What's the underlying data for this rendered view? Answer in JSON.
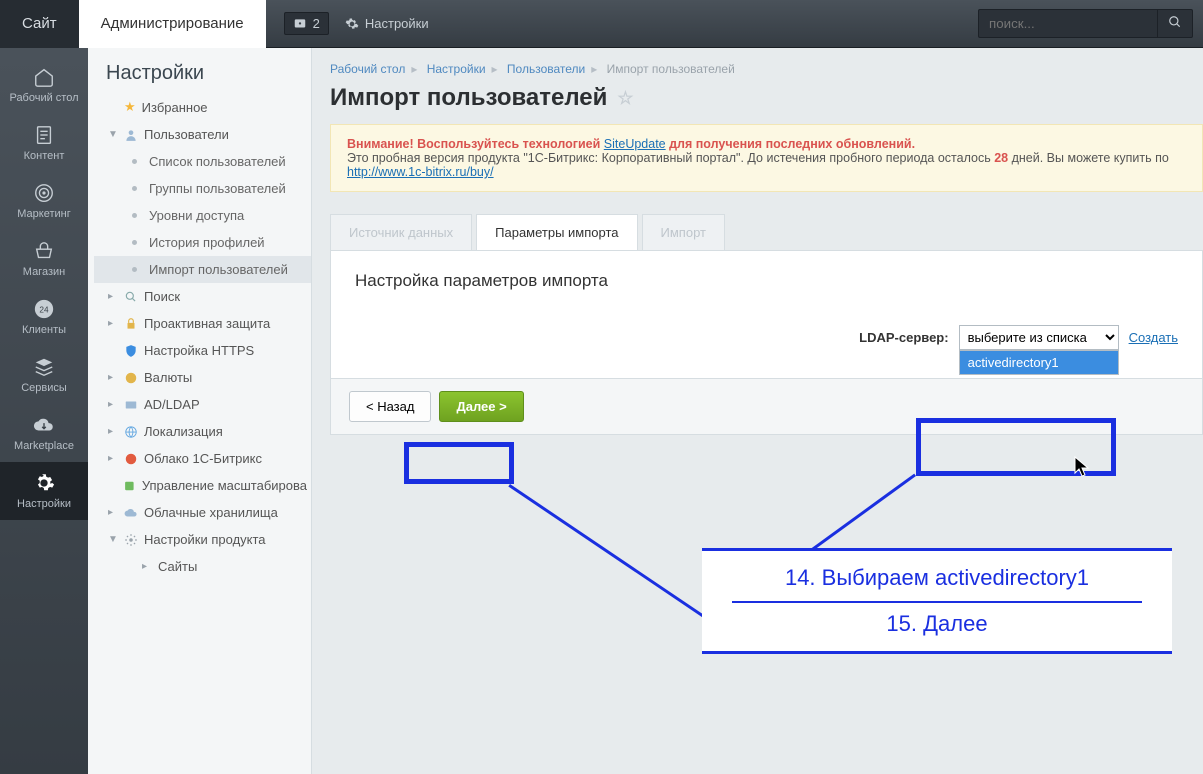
{
  "topbar": {
    "site": "Сайт",
    "admin": "Администрирование",
    "notif_count": "2",
    "settings": "Настройки",
    "search_placeholder": "поиск..."
  },
  "iconbar": [
    {
      "name": "desk",
      "label": "Рабочий стол"
    },
    {
      "name": "content",
      "label": "Контент"
    },
    {
      "name": "marketing",
      "label": "Маркетинг"
    },
    {
      "name": "shop",
      "label": "Магазин"
    },
    {
      "name": "clients",
      "label": "Клиенты"
    },
    {
      "name": "services",
      "label": "Сервисы"
    },
    {
      "name": "marketplace",
      "label": "Marketplace"
    },
    {
      "name": "settings",
      "label": "Настройки"
    }
  ],
  "tree": {
    "title": "Настройки",
    "fav": "Избранное",
    "users": "Пользователи",
    "users_sub": [
      "Список пользователей",
      "Группы пользователей",
      "Уровни доступа",
      "История профилей",
      "Импорт пользователей"
    ],
    "search": "Поиск",
    "proactive": "Проактивная защита",
    "https": "Настройка HTTPS",
    "currency": "Валюты",
    "adldap": "AD/LDAP",
    "local": "Локализация",
    "cloud": "Облако 1С-Битрикс",
    "scale": "Управление масштабирова",
    "cloudstore": "Облачные хранилища",
    "prodset": "Настройки продукта",
    "sites": "Сайты"
  },
  "breadcrumb": [
    "Рабочий стол",
    "Настройки",
    "Пользователи",
    "Импорт пользователей"
  ],
  "page_title": "Импорт пользователей",
  "warn": {
    "l1a": "Внимание! Воспользуйтесь технологией ",
    "l1link": "SiteUpdate",
    "l1b": " для получения последних обновлений.",
    "l2a": "Это пробная версия продукта \"1С-Битрикс: Корпоративный портал\". До истечения пробного периода осталось ",
    "l2days": "28",
    "l2b": " дней. Вы можете купить по",
    "l3": "http://www.1c-bitrix.ru/buy/"
  },
  "tabs": [
    "Источник данных",
    "Параметры импорта",
    "Импорт"
  ],
  "pane": {
    "heading": "Настройка параметров импорта",
    "ldap_label": "LDAP-сервер:",
    "select_placeholder": "выберите из списка",
    "create": "Создать",
    "option": "activedirectory1"
  },
  "buttons": {
    "back": "< Назад",
    "next": "Далее >"
  },
  "annotations": {
    "a14": "14. Выбираем activedirectory1",
    "a15": "15. Далее"
  }
}
